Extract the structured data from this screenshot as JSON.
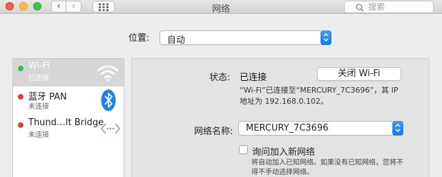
{
  "window": {
    "title": "网络"
  },
  "toolbar": {
    "back_glyph": "‹",
    "forward_glyph": "›"
  },
  "search": {
    "placeholder": "搜索"
  },
  "location": {
    "label": "位置:",
    "value": "自动"
  },
  "services": [
    {
      "name": "Wi-Fi",
      "status": "已连接",
      "status_color": "#2fbf45",
      "icon": "wifi-icon",
      "selected": true
    },
    {
      "name": "蓝牙 PAN",
      "status": "未连接",
      "status_color": "#e43b3b",
      "icon": "bluetooth-icon",
      "selected": false
    },
    {
      "name": "Thund…lt Bridge",
      "status": "未连接",
      "status_color": "#e43b3b",
      "icon": "thunderbolt-bridge-icon",
      "selected": false
    }
  ],
  "detail": {
    "status_label": "状态:",
    "status_value": "已连接",
    "turn_off_button": "关闭 Wi-Fi",
    "status_desc_line1": "“Wi-Fi”已连接至“MERCURY_7C3696”，其 IP",
    "status_desc_line2": "地址为 192.168.0.102。",
    "network_name_label": "网络名称:",
    "network_name_value": "MERCURY_7C3696",
    "ask_join_label": "询问加入新网络",
    "ask_join_checked": false,
    "ask_join_desc_line1": "将自动加入已知网络。如果没有已知网络，您将不",
    "ask_join_desc_line2": "得不手动选择网络。"
  },
  "colors": {
    "accent": "#1a7ae8",
    "connected": "#2fbf45",
    "disconnected": "#e43b3b"
  }
}
